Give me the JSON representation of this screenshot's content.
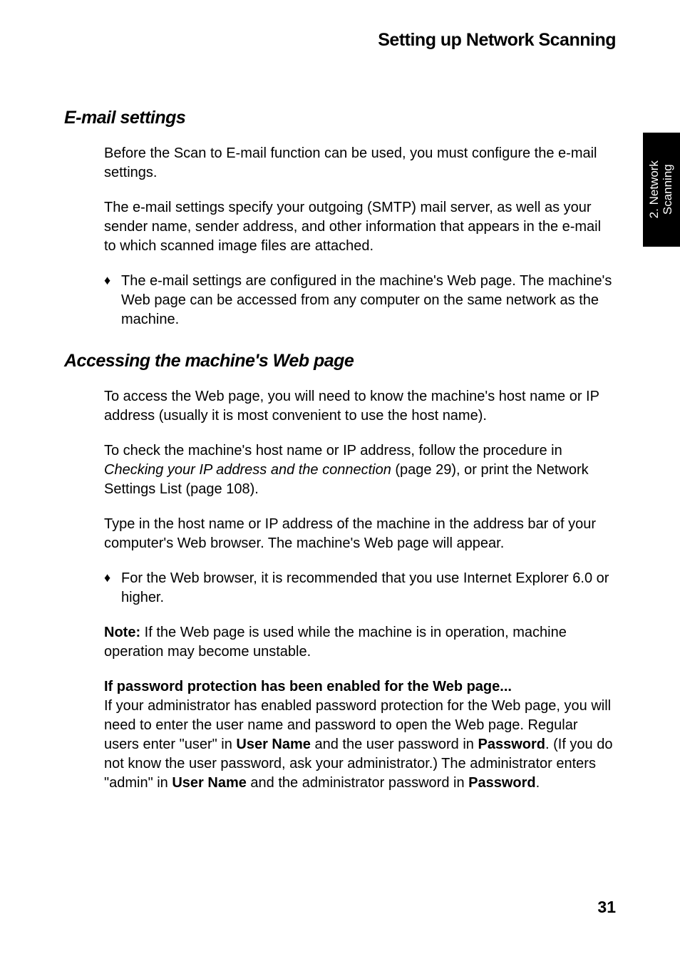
{
  "header": {
    "title": "Setting up Network Scanning"
  },
  "sideTab": {
    "line1": "2. Network",
    "line2": "Scanning"
  },
  "sections": {
    "email": {
      "heading": "E-mail settings",
      "p1": "Before the Scan to E-mail function can be used, you must configure the e-mail settings.",
      "p2": "The e-mail settings specify your outgoing (SMTP) mail server, as well as your sender name, sender address, and other information that appears in the e-mail to which scanned image files are attached.",
      "bullet1": "The e-mail settings are configured in the machine's Web page. The machine's Web page can be accessed from any computer on the same network as the machine."
    },
    "webpage": {
      "heading": "Accessing the machine's Web page",
      "p1": "To access the Web page, you will need to know the machine's host name or IP address (usually it is most convenient to use the host name).",
      "p2_a": "To check the machine's host name or IP address, follow the procedure in ",
      "p2_b": "Checking your IP address and the connection",
      "p2_c": " (page 29), or print the Network Settings List (page 108).",
      "p3": "Type in the host name or IP address of the machine in the address bar of your computer's Web browser. The machine's Web page will appear.",
      "bullet1": "For the Web browser, it is recommended that you use Internet Explorer 6.0 or higher.",
      "note_label": "Note:",
      "note_body": " If the Web page is used while the machine is in operation, machine operation may become unstable.",
      "pw_heading": "If password protection has been enabled for the Web page...",
      "pw_1": "If your administrator has enabled password protection for the Web page, you will need to enter the user name and password to open the Web page. Regular users enter \"user\" in ",
      "pw_un": "User Name",
      "pw_2": " and the user password in ",
      "pw_pw": "Password",
      "pw_3": ". (If you do not know the user password, ask your administrator.) The administrator enters \"admin\" in ",
      "pw_4": " and the administrator password in ",
      "pw_5": "."
    }
  },
  "pageNumber": "31"
}
